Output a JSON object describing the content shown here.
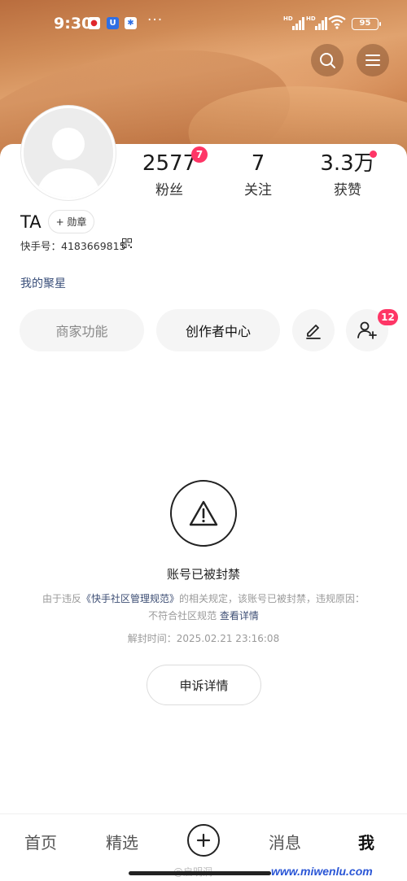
{
  "status_bar": {
    "time": "9:30",
    "more": "···",
    "hd1": "HD",
    "hd2": "HD",
    "battery": "95",
    "app_icons": [
      "red-app-icon",
      "blue-u-app-icon",
      "blue-app-icon"
    ]
  },
  "header": {
    "search_icon": "search-icon",
    "menu_icon": "menu-icon"
  },
  "profile": {
    "name": "TA",
    "medal_label": "+ 勋章",
    "kuaishou_id": "快手号：4183669815",
    "star_link": "我的聚星"
  },
  "stats": [
    {
      "value": "2577",
      "label": "粉丝",
      "badge": "7"
    },
    {
      "value": "7",
      "label": "关注",
      "badge": ""
    },
    {
      "value": "3.3万",
      "label": "获赞",
      "badge": ""
    }
  ],
  "actions": {
    "merchant": "商家功能",
    "creator": "创作者中心",
    "add_friend_badge": "12"
  },
  "ban": {
    "title": "账号已被封禁",
    "desc_prefix": "由于违反",
    "desc_link": "《快手社区管理规范》",
    "desc_middle": "的相关规定，该账号已被封禁，违规原因：不符合社区规范",
    "desc_detail_link": "查看详情",
    "unban_time": "解封时间：2025.02.21 23:16:08",
    "appeal": "申诉详情"
  },
  "bottom_nav": {
    "home": "首页",
    "featured": "精选",
    "messages": "消息",
    "me": "我"
  },
  "watermarks": {
    "weibo": "@启明洞",
    "site": "www.miwenlu.com"
  },
  "colors": {
    "badge": "#fe3666",
    "link": "#3d4e74",
    "watermark": "#2a56d6"
  }
}
